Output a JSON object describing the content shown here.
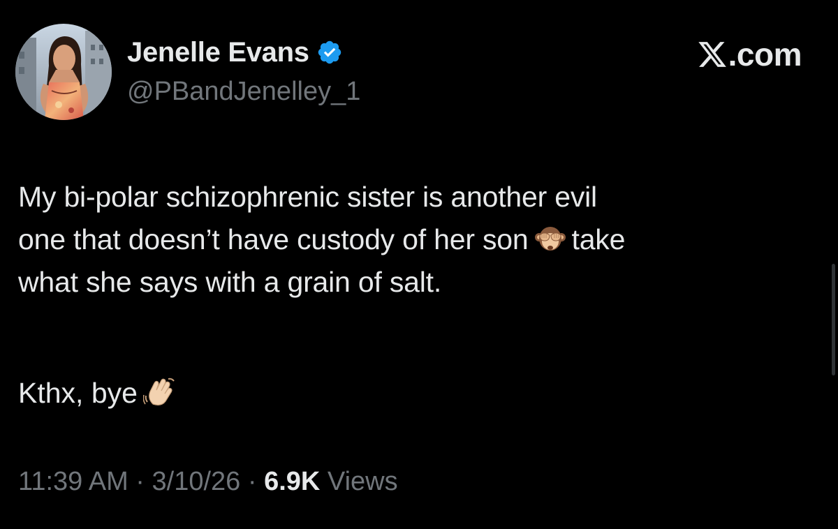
{
  "author": {
    "display_name": "Jenelle Evans",
    "handle": "@PBandJenelley_1",
    "verified": true,
    "verified_color": "#1d9bf0"
  },
  "brand": {
    "logo": "x-logo-icon",
    "text": ".com"
  },
  "post": {
    "lines": [
      "My bi-polar schizophrenic sister is another evil",
      "one that doesn’t have custody of her son",
      "take",
      "what she says with a grain of salt."
    ],
    "inline_emoji": "see-no-evil-monkey-icon",
    "signoff": "Kthx, bye",
    "signoff_emoji": "waving-hand-icon"
  },
  "meta": {
    "time": "11:39 AM",
    "sep1": " · ",
    "date": "3/10/26",
    "sep2": " · ",
    "views_count": "6.9K",
    "views_label": " Views"
  },
  "colors": {
    "background": "#000000",
    "text": "#e7e9ea",
    "secondary": "#71767b"
  }
}
